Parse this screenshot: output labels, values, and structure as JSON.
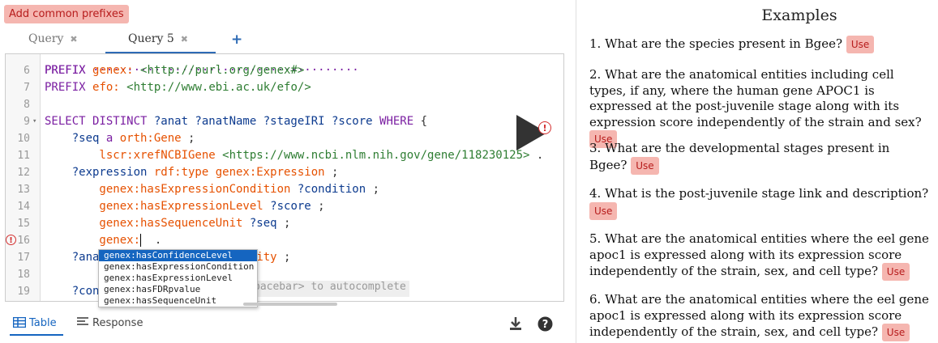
{
  "toolbar": {
    "add_prefixes": "Add common prefixes"
  },
  "tabs": [
    {
      "label": "Query",
      "close": "✖"
    },
    {
      "label": "Query 5",
      "close": "✖"
    }
  ],
  "add_tab": "+",
  "editor": {
    "lines": [
      {
        "n": "6",
        "parts": [
          {
            "t": "PREFIX ",
            "c": "kw"
          },
          {
            "t": "genex: ",
            "c": "pfx"
          },
          {
            "t": "<http://purl.org/genex#>",
            "c": "iri"
          }
        ]
      },
      {
        "n": "7",
        "parts": [
          {
            "t": "PREFIX ",
            "c": "kw"
          },
          {
            "t": "efo: ",
            "c": "pfx"
          },
          {
            "t": "<http://www.ebi.ac.uk/efo/>",
            "c": "iri"
          }
        ]
      },
      {
        "n": "8",
        "parts": []
      },
      {
        "n": "9",
        "fold": true,
        "parts": [
          {
            "t": "SELECT DISTINCT ",
            "c": "kw"
          },
          {
            "t": "?anat ?anatName ?stageIRI ?score ",
            "c": "var"
          },
          {
            "t": "WHERE",
            "c": "kw"
          },
          {
            "t": " {",
            "c": "pn"
          }
        ]
      },
      {
        "n": "10",
        "parts": [
          {
            "t": "    ?seq ",
            "c": "var"
          },
          {
            "t": "a ",
            "c": "kw"
          },
          {
            "t": "orth:Gene",
            "c": "pfx"
          },
          {
            "t": " ;",
            "c": "pn"
          }
        ]
      },
      {
        "n": "11",
        "parts": [
          {
            "t": "        lscr:xrefNCBIGene ",
            "c": "pfx"
          },
          {
            "t": "<https://www.ncbi.nlm.nih.gov/gene/118230125>",
            "c": "iri"
          },
          {
            "t": " .",
            "c": "pn"
          }
        ]
      },
      {
        "n": "12",
        "parts": [
          {
            "t": "    ?expression ",
            "c": "var"
          },
          {
            "t": "rdf:type genex:Expression",
            "c": "pfx"
          },
          {
            "t": " ;",
            "c": "pn"
          }
        ]
      },
      {
        "n": "13",
        "parts": [
          {
            "t": "        genex:hasExpressionCondition ",
            "c": "pfx"
          },
          {
            "t": "?condition",
            "c": "var"
          },
          {
            "t": " ;",
            "c": "pn"
          }
        ]
      },
      {
        "n": "14",
        "parts": [
          {
            "t": "        genex:hasExpressionLevel ",
            "c": "pfx"
          },
          {
            "t": "?score",
            "c": "var"
          },
          {
            "t": " ;",
            "c": "pn"
          }
        ]
      },
      {
        "n": "15",
        "parts": [
          {
            "t": "        genex:hasSequenceUnit ",
            "c": "pfx"
          },
          {
            "t": "?seq",
            "c": "var"
          },
          {
            "t": " ;",
            "c": "pn"
          }
        ]
      },
      {
        "n": "16",
        "error": true,
        "parts": [
          {
            "t": "        genex:",
            "c": "pfx"
          },
          {
            "t": " ",
            "c": "cursor"
          },
          {
            "t": " .",
            "c": "pn"
          }
        ]
      },
      {
        "n": "17",
        "parts": [
          {
            "t": "    ?ana",
            "c": "var"
          },
          {
            "t": "                       ",
            "c": "pn"
          },
          {
            "t": "ity",
            "c": "pfx"
          },
          {
            "t": " ;",
            "c": "pn"
          }
        ]
      },
      {
        "n": "18",
        "parts": []
      },
      {
        "n": "19",
        "parts": [
          {
            "t": "    ?con",
            "c": "var"
          }
        ]
      }
    ],
    "hint": "pacebar> to autocomplete",
    "autocomplete": [
      "genex:hasConfidenceLevel",
      "genex:hasExpressionCondition",
      "genex:hasExpressionLevel",
      "genex:hasFDRpvalue",
      "genex:hasSequenceUnit"
    ]
  },
  "results": {
    "table_label": "Table",
    "response_label": "Response"
  },
  "examples": {
    "title": "Examples",
    "use_label": "Use",
    "items": [
      "1. What are the species present in Bgee?",
      "2. What are the anatomical entities including cell types, if any, where the human gene APOC1 is expressed at the post-juvenile stage along with its expression score independently of the strain and sex?",
      "3. What are the developmental stages present in Bgee?",
      "4. What is the post-juvenile stage link and description?",
      "5. What are the anatomical entities where the eel gene apoc1 is expressed along with its expression score independently of the strain, sex, and cell type?",
      "6. What are the anatomical entities where the eel gene apoc1 is expressed along with its expression score independently of the strain, sex, and cell type?"
    ]
  },
  "colors": {
    "accent": "#1565c0",
    "use_bg": "#f5b6b0",
    "use_fg": "#b71c1c",
    "keyword": "#7b1fa2",
    "iri": "#2e7d32",
    "prefixed": "#e65100",
    "variable": "#0d3b8f",
    "error": "#d32f2f"
  }
}
